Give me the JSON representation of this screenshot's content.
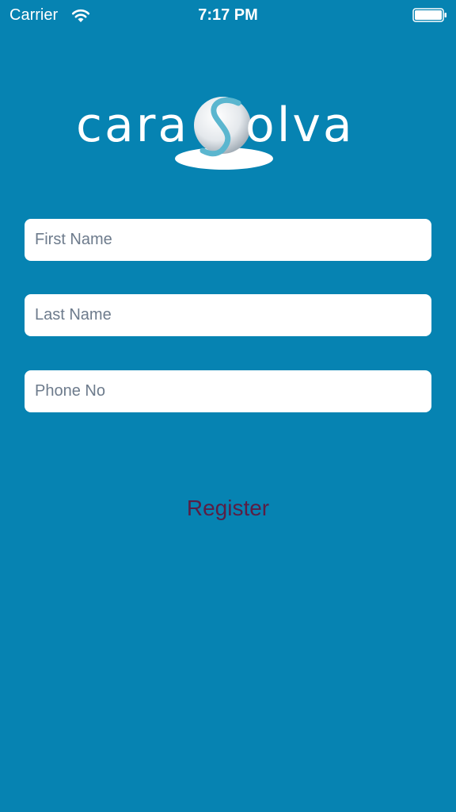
{
  "status_bar": {
    "carrier": "Carrier",
    "time": "7:17 PM",
    "wifi_icon": "wifi-icon",
    "battery_icon": "battery-icon"
  },
  "logo": {
    "text_left": "cara",
    "text_right": "olva",
    "icon": "swirl-sphere-logo"
  },
  "form": {
    "first_name_placeholder": "First Name",
    "first_name_value": "",
    "last_name_placeholder": "Last Name",
    "last_name_value": "",
    "phone_placeholder": "Phone No",
    "phone_value": "",
    "register_label": "Register"
  },
  "colors": {
    "background": "#0683b2",
    "field_background": "#ffffff",
    "register_text": "#5a1e44",
    "placeholder": "#6d7b8c"
  }
}
